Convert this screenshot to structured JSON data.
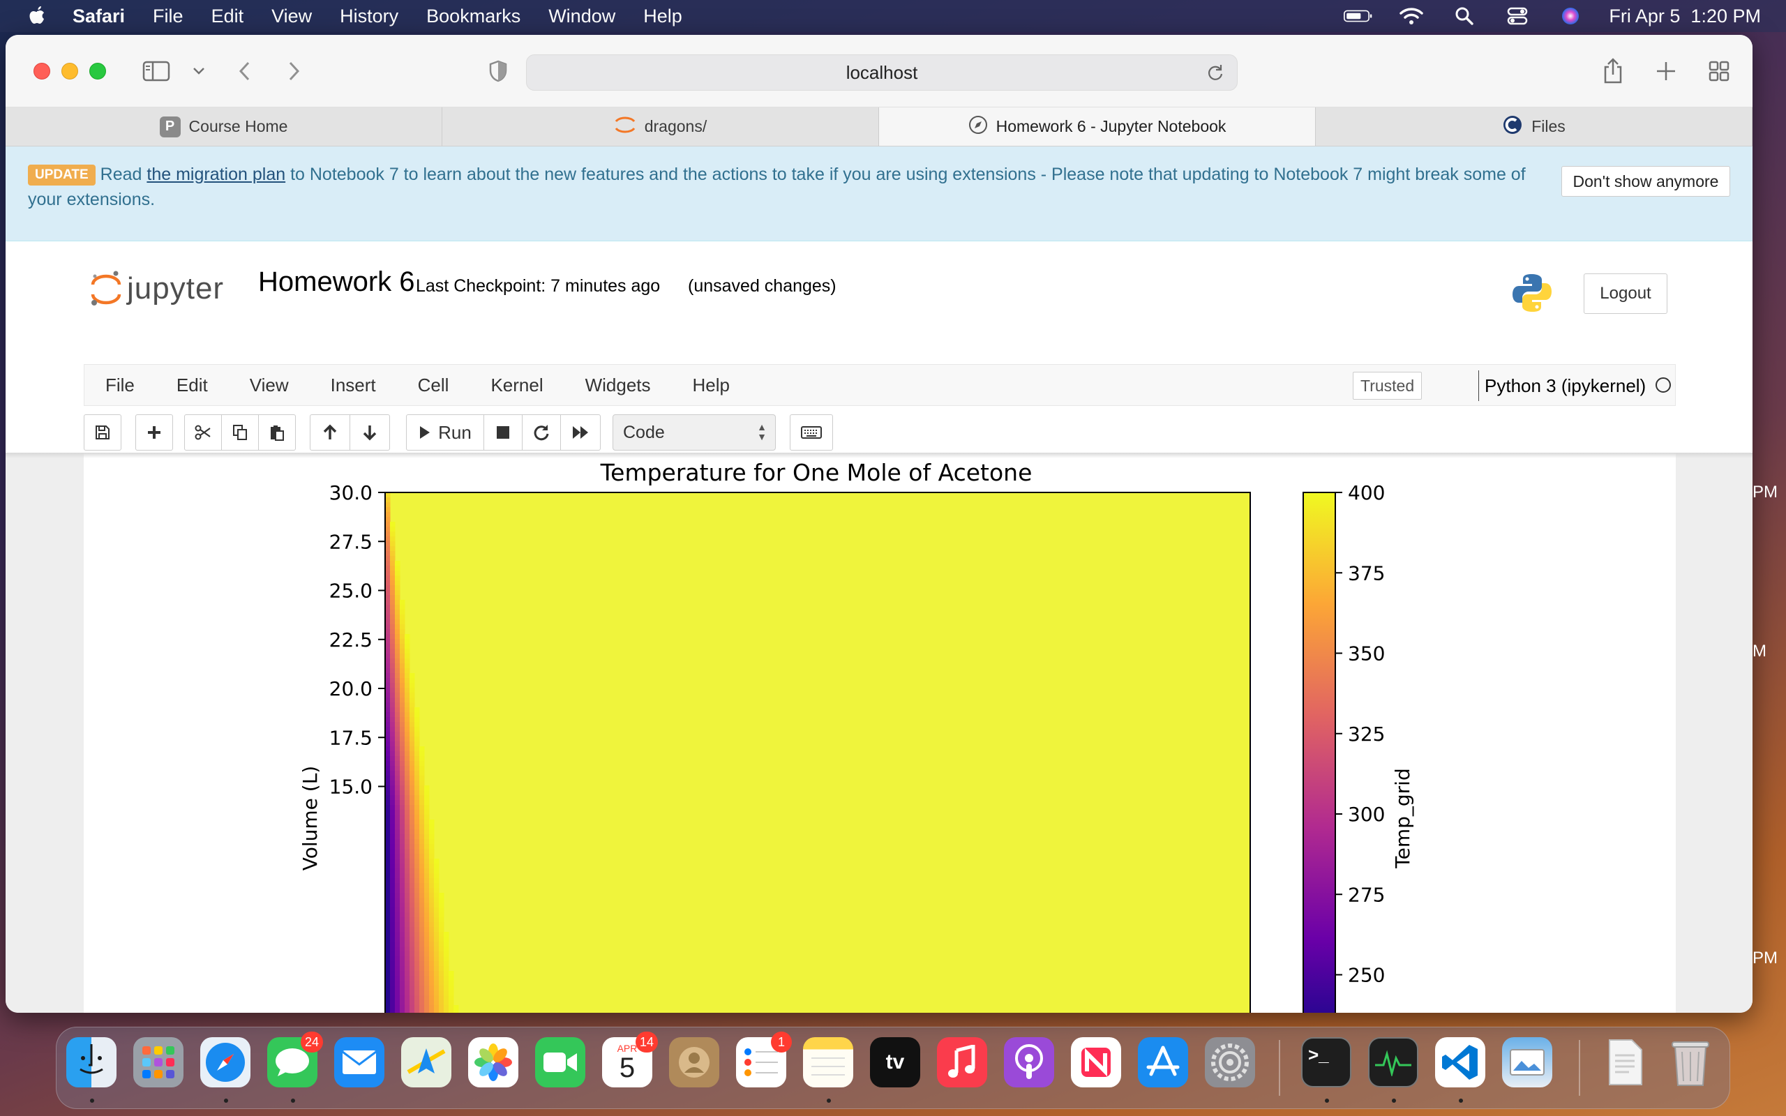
{
  "menubar": {
    "app_name": "Safari",
    "items": [
      "File",
      "Edit",
      "View",
      "History",
      "Bookmarks",
      "Window",
      "Help"
    ],
    "clock": "Fri Apr 5  1:20 PM"
  },
  "browser": {
    "url": "localhost",
    "tabs": [
      {
        "label": "Course Home",
        "icon": "P"
      },
      {
        "label": "dragons/",
        "icon": "jupyter-logo"
      },
      {
        "label": "Homework 6 - Jupyter Notebook",
        "icon": "compass"
      },
      {
        "label": "Files",
        "icon": "files-logo"
      }
    ]
  },
  "banner": {
    "badge": "UPDATE",
    "text_before": "Read ",
    "link_text": "the migration plan",
    "text_after": " to Notebook 7 to learn about the new features and the actions to take if you are using extensions - Please note that updating to Notebook 7 might break some of your extensions.",
    "dismiss_label": "Don't show anymore"
  },
  "jupyter": {
    "logo_text": "jupyter",
    "notebook_title": "Homework 6",
    "checkpoint": "Last Checkpoint: 7 minutes ago",
    "unsaved": "(unsaved changes)",
    "logout_label": "Logout",
    "menu": [
      "File",
      "Edit",
      "View",
      "Insert",
      "Cell",
      "Kernel",
      "Widgets",
      "Help"
    ],
    "trusted_label": "Trusted",
    "kernel_name": "Python 3 (ipykernel)",
    "run_label": "Run",
    "cell_type": "Code"
  },
  "chart_data": {
    "type": "heatmap",
    "title": "Temperature for One Mole of Acetone",
    "ylabel": "Volume (L)",
    "colorbar_label": "Temp_grid",
    "yticks": [
      "30.0",
      "27.5",
      "25.0",
      "22.5",
      "20.0",
      "17.5",
      "15.0"
    ],
    "colorbar_ticks": [
      "400",
      "375",
      "350",
      "325",
      "300",
      "275",
      "250"
    ],
    "colorbar_range": [
      225,
      400
    ],
    "colormap": "plasma",
    "saturated_color": "#eff43c",
    "visible_y_range": [
      13,
      30
    ]
  },
  "side_labels": [
    "PM",
    "M",
    "PM"
  ],
  "dock": {
    "badges": {
      "messages": "24",
      "calendar_day": "5",
      "calendar_month": "APR",
      "calendar_badge": "14",
      "reminders": "1"
    }
  }
}
